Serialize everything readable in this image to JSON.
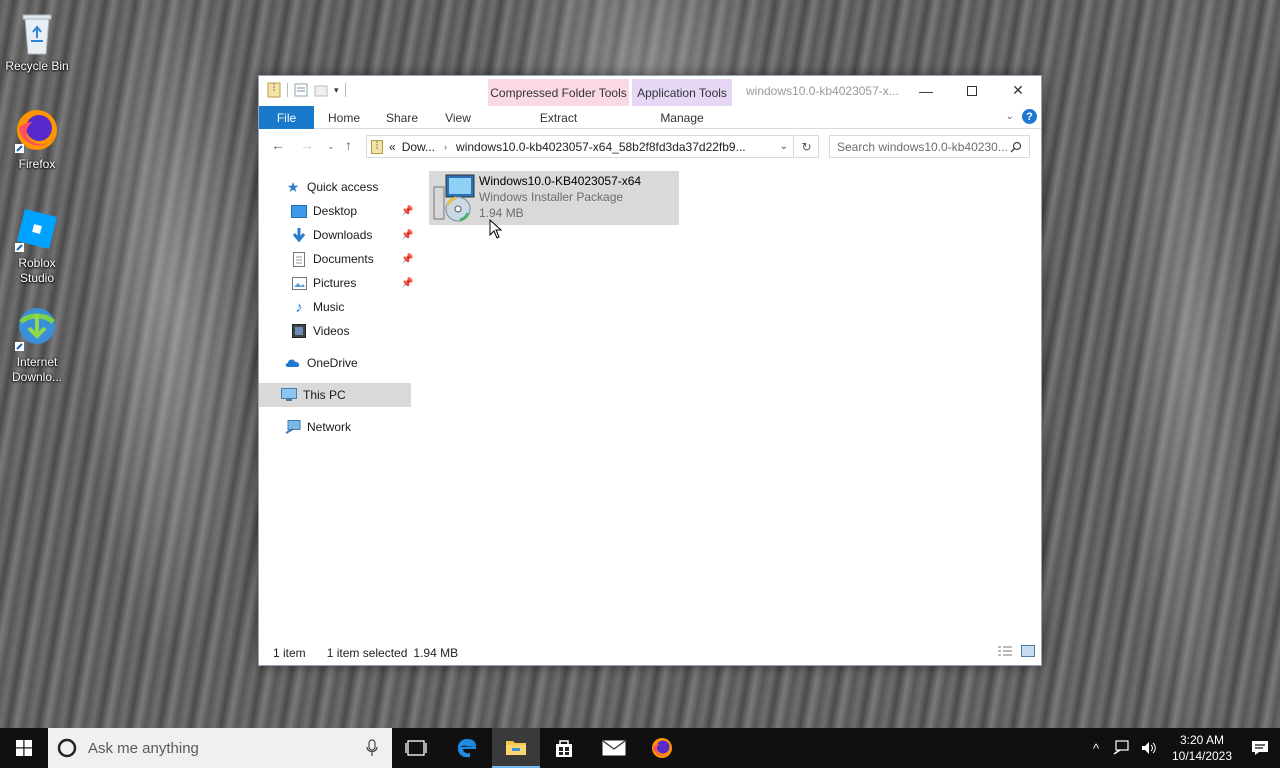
{
  "desktop": {
    "icons": [
      {
        "label": "Recycle Bin"
      },
      {
        "label": "Firefox"
      },
      {
        "label": "Roblox Studio"
      },
      {
        "label": "Internet Downlo..."
      }
    ]
  },
  "window": {
    "title": "windows10.0-kb4023057-x...",
    "context_tabs": {
      "compressed": "Compressed Folder Tools",
      "application": "Application Tools"
    },
    "ribbon_tabs": {
      "file": "File",
      "home": "Home",
      "share": "Share",
      "view": "View",
      "extract": "Extract",
      "manage": "Manage"
    },
    "address": {
      "chevron": "«",
      "crumb1": "Dow...",
      "crumb2": "windows10.0-kb4023057-x64_58b2f8fd3da37d22fb9..."
    },
    "search_placeholder": "Search windows10.0-kb40230...",
    "nav": {
      "quick_access": "Quick access",
      "desktop": "Desktop",
      "downloads": "Downloads",
      "documents": "Documents",
      "pictures": "Pictures",
      "music": "Music",
      "videos": "Videos",
      "onedrive": "OneDrive",
      "this_pc": "This PC",
      "network": "Network"
    },
    "file": {
      "name": "Windows10.0-KB4023057-x64",
      "type": "Windows Installer Package",
      "size": "1.94 MB"
    },
    "status": {
      "count": "1 item",
      "selected": "1 item selected",
      "size": "1.94 MB"
    }
  },
  "taskbar": {
    "search_placeholder": "Ask me anything",
    "time": "3:20 AM",
    "date": "10/14/2023"
  }
}
